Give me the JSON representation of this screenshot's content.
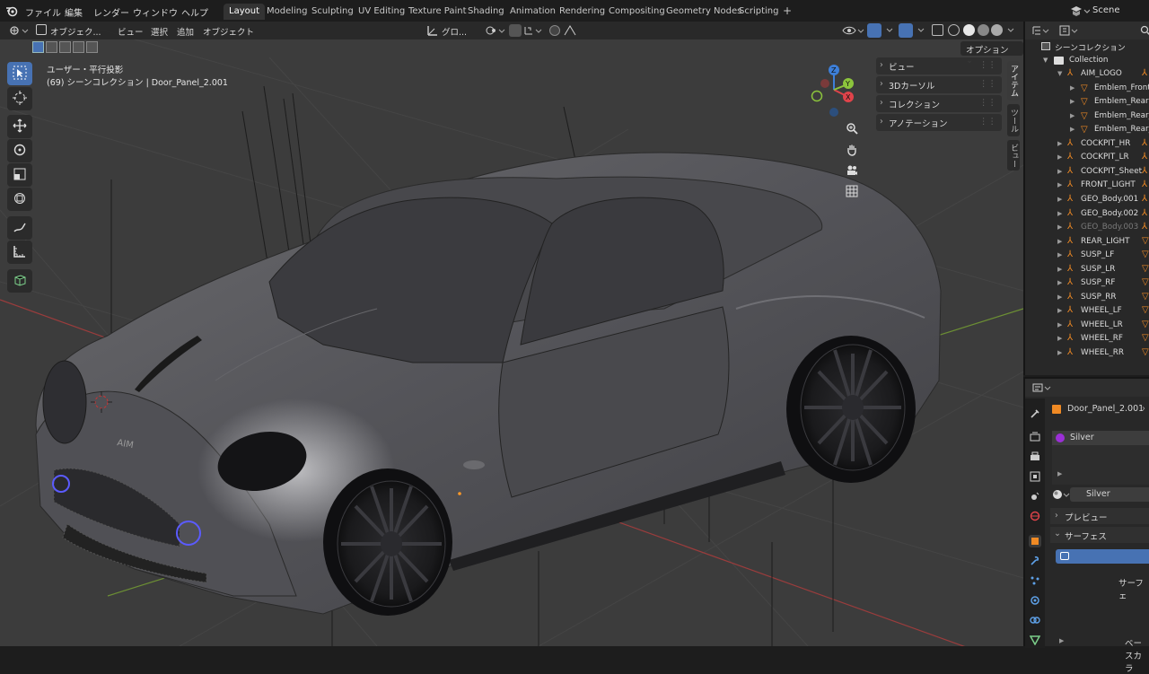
{
  "menubar": {
    "items": [
      "ファイル",
      "編集",
      "レンダー",
      "ウィンドウ",
      "ヘルプ"
    ],
    "workspaces": [
      "Layout",
      "Modeling",
      "Sculpting",
      "UV Editing",
      "Texture Paint",
      "Shading",
      "Animation",
      "Rendering",
      "Compositing",
      "Geometry Nodes",
      "Scripting"
    ],
    "active_workspace": "Layout",
    "add_tab": "+",
    "scene_label": "Scene"
  },
  "viewport": {
    "mode": "オブジェク...",
    "menus": [
      "ビュー",
      "選択",
      "追加",
      "オブジェクト"
    ],
    "transform_orientation": "グロ...",
    "options_label": "オプション",
    "view_name": "ユーザー・平行投影",
    "collection_info": "(69) シーンコレクション | Door_Panel_2.001",
    "n_panel_items": [
      "ビュー",
      "3Dカーソル",
      "コレクション",
      "アノテーション"
    ],
    "vertical_tabs": [
      "アイテム",
      "ツール",
      "ビュー"
    ],
    "car_badge": "AIM",
    "gizmo_axes": {
      "x": "X",
      "y": "Y",
      "z": "Z"
    },
    "colors": {
      "x_axis": "#e0434a",
      "y_axis": "#8cc43c",
      "z_axis": "#3d7fd9",
      "car_body": "#5a5a5c",
      "accent_blue": "#5b5bff"
    }
  },
  "outliner": {
    "root": "シーンコレクション",
    "collection": "Collection",
    "items": [
      {
        "name": "AIM_LOGO",
        "level": 1,
        "expanded": true
      },
      {
        "name": "Emblem_Front",
        "level": 2
      },
      {
        "name": "Emblem_Rear",
        "level": 2
      },
      {
        "name": "Emblem_Rear_L",
        "level": 2
      },
      {
        "name": "Emblem_Rear_R",
        "level": 2
      },
      {
        "name": "COCKPIT_HR",
        "level": 1
      },
      {
        "name": "COCKPIT_LR",
        "level": 1
      },
      {
        "name": "COCKPIT_Sheet",
        "level": 1
      },
      {
        "name": "FRONT_LIGHT",
        "level": 1
      },
      {
        "name": "GEO_Body.001",
        "level": 1
      },
      {
        "name": "GEO_Body.002",
        "level": 1
      },
      {
        "name": "GEO_Body.003",
        "level": 1,
        "dim": true
      },
      {
        "name": "REAR_LIGHT",
        "level": 1
      },
      {
        "name": "SUSP_LF",
        "level": 1
      },
      {
        "name": "SUSP_LR",
        "level": 1
      },
      {
        "name": "SUSP_RF",
        "level": 1
      },
      {
        "name": "SUSP_RR",
        "level": 1
      },
      {
        "name": "WHEEL_LF",
        "level": 1
      },
      {
        "name": "WHEEL_LR",
        "level": 1
      },
      {
        "name": "WHEEL_RF",
        "level": 1
      },
      {
        "name": "WHEEL_RR",
        "level": 1
      }
    ]
  },
  "properties": {
    "object_name": "Door_Panel_2.001",
    "material_slot": "Silver",
    "material_name": "Silver",
    "preview_label": "プレビュー",
    "surface_label": "サーフェス",
    "surface_field": "サーフェ",
    "base_color_label": "ベースカラ",
    "material_color": "#9b2fd6"
  }
}
